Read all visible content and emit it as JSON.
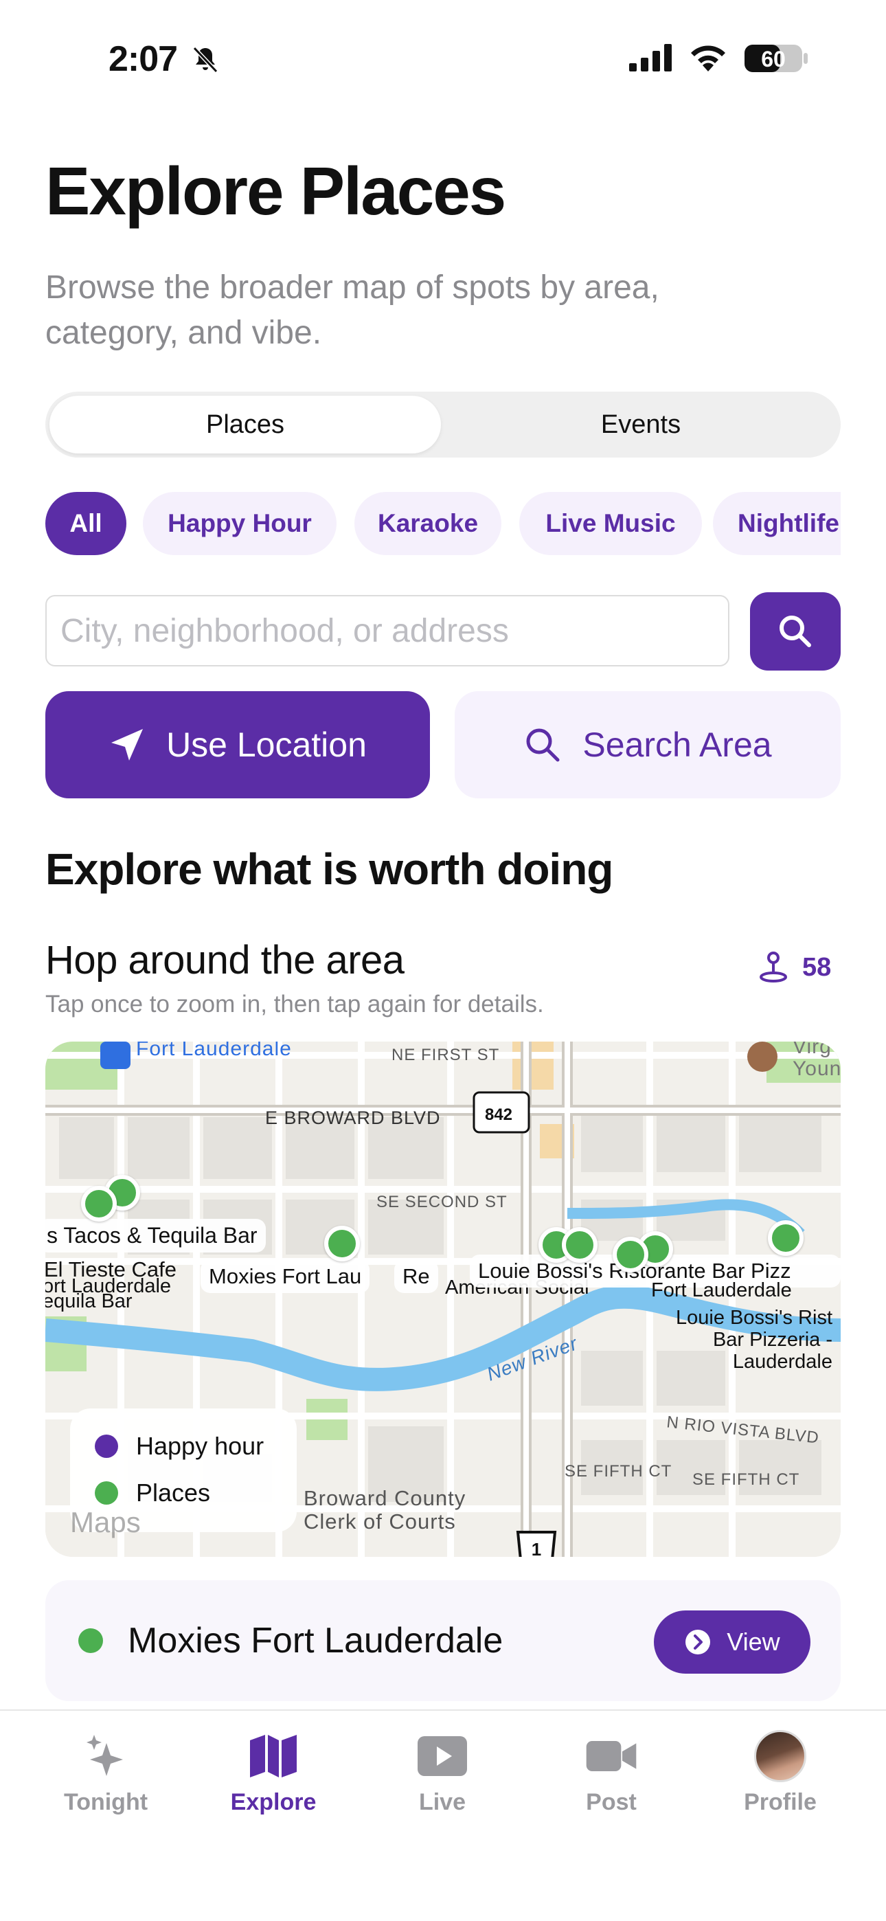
{
  "status": {
    "time": "2:07",
    "battery": "60"
  },
  "header": {
    "title": "Explore Places",
    "subtitle": "Browse the broader map of spots by area, category, and vibe."
  },
  "segments": {
    "places": "Places",
    "events": "Events"
  },
  "chips": [
    "All",
    "Happy Hour",
    "Karaoke",
    "Live Music",
    "Nightlife"
  ],
  "search": {
    "placeholder": "City, neighborhood, or address",
    "value": ""
  },
  "actions": {
    "use_location": "Use Location",
    "search_area": "Search Area"
  },
  "section": {
    "title": "Explore what is worth doing",
    "hop_title": "Hop around the area",
    "hop_count": "58",
    "hop_hint": "Tap once to zoom in, then tap again for details."
  },
  "map": {
    "labels": {
      "fort_lauderdale": "Fort Lauderdale",
      "ne_first": "NE FIRST ST",
      "broward": "E BROWARD BLVD",
      "se_second": "SE SECOND ST",
      "new_river": "New River",
      "rio_vista": "N RIO VISTA BLVD",
      "se_fifth_ct": "SE FIFTH CT",
      "se_fifth_ct2": "SE FIFTH CT",
      "clerk": "Broward County Clerk of Courts",
      "virgin": "Virg Youn",
      "route842": "842",
      "route1": "1",
      "watermark": "Maps"
    },
    "place_labels": {
      "tacos": "s Tacos & Tequila Bar",
      "el_tieste": "El Tieste Cafe",
      "moxies": "Moxies Fort Lau",
      "re": "Re",
      "american_social": "American Social",
      "louie_bossi": "Louie Bossi's Ristorante Bar Pizz",
      "louie_bossi_sub": "Louie Bossi's Rist Bar Pizzeria - Lauderdale",
      "ort_lauderdale": "ort Lauderdale",
      "equila": "equila Bar",
      "fort_lauderdale2": "Fort Lauderdale"
    },
    "legend": {
      "happy_hour": "Happy hour",
      "places": "Places"
    },
    "legend_colors": {
      "happy_hour": "#5b2da6",
      "places": "#4caf50"
    }
  },
  "selected_place": {
    "name": "Moxies Fort Lauderdale",
    "view_label": "View"
  },
  "tabs": {
    "tonight": "Tonight",
    "explore": "Explore",
    "live": "Live",
    "post": "Post",
    "profile": "Profile"
  },
  "colors": {
    "accent": "#5b2da6",
    "pin": "#4caf50"
  }
}
